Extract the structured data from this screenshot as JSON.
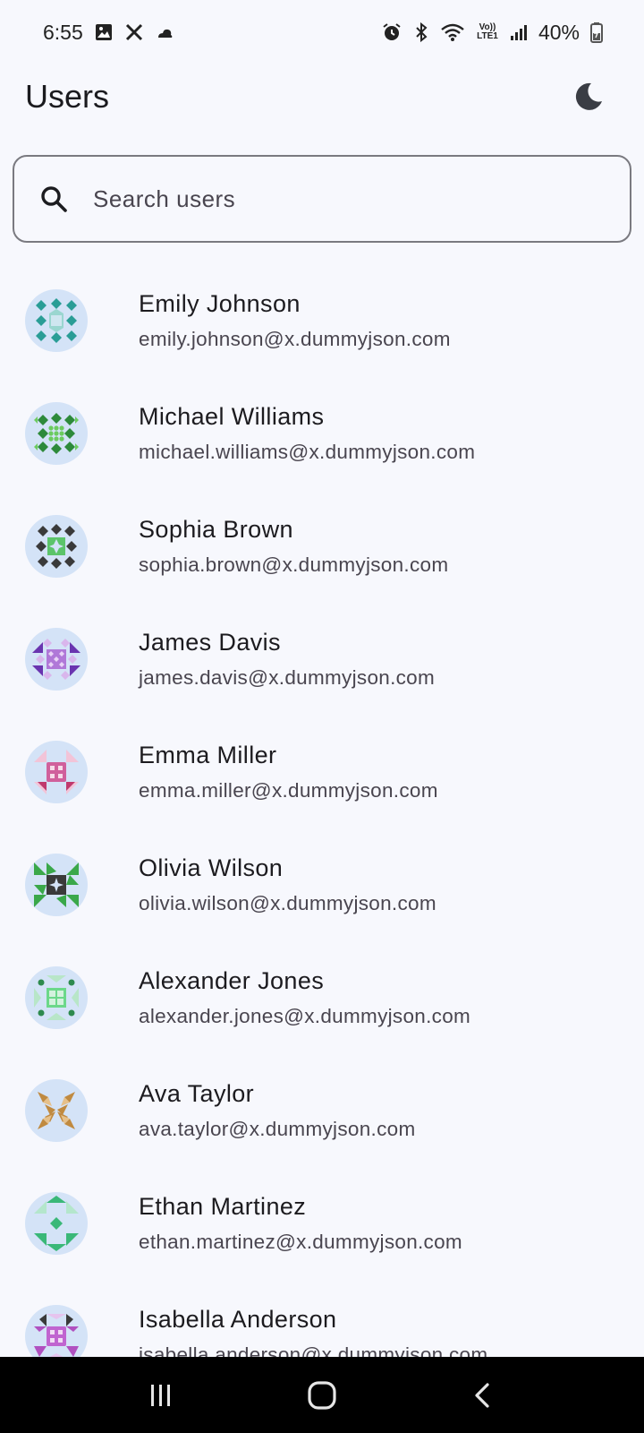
{
  "status_bar": {
    "time": "6:55",
    "battery": "40%",
    "icons_left": [
      "gallery-icon",
      "x-icon",
      "weather-icon"
    ],
    "icons_right": [
      "alarm-icon",
      "bluetooth-icon",
      "wifi-icon",
      "volte-icon",
      "signal-icon",
      "battery-icon"
    ],
    "volte_label": "Vo)) LTE1"
  },
  "header": {
    "title": "Users",
    "theme_icon": "moon-icon"
  },
  "search": {
    "placeholder": "Search users",
    "value": ""
  },
  "users": [
    {
      "name": "Emily Johnson",
      "email": "emily.johnson@x.dummyjson.com",
      "avatar_color": "#2a9d96"
    },
    {
      "name": "Michael Williams",
      "email": "michael.williams@x.dummyjson.com",
      "avatar_color": "#3aa84a"
    },
    {
      "name": "Sophia Brown",
      "email": "sophia.brown@x.dummyjson.com",
      "avatar_color": "#4a4a4a"
    },
    {
      "name": "James Davis",
      "email": "james.davis@x.dummyjson.com",
      "avatar_color": "#7a3fb5"
    },
    {
      "name": "Emma Miller",
      "email": "emma.miller@x.dummyjson.com",
      "avatar_color": "#c05a9c"
    },
    {
      "name": "Olivia Wilson",
      "email": "olivia.wilson@x.dummyjson.com",
      "avatar_color": "#3aa84a"
    },
    {
      "name": "Alexander Jones",
      "email": "alexander.jones@x.dummyjson.com",
      "avatar_color": "#3aa860"
    },
    {
      "name": "Ava Taylor",
      "email": "ava.taylor@x.dummyjson.com",
      "avatar_color": "#c08a40"
    },
    {
      "name": "Ethan Martinez",
      "email": "ethan.martinez@x.dummyjson.com",
      "avatar_color": "#3ab878"
    },
    {
      "name": "Isabella Anderson",
      "email": "isabella.anderson@x.dummyjson.com",
      "avatar_color": "#b050c0"
    }
  ],
  "nav": {
    "recents_icon": "recents-icon",
    "home_icon": "home-icon",
    "back_icon": "back-icon"
  },
  "colors": {
    "background": "#f7f8fd",
    "avatar_bg": "#d4e3f7",
    "nav_bg": "#000000"
  }
}
